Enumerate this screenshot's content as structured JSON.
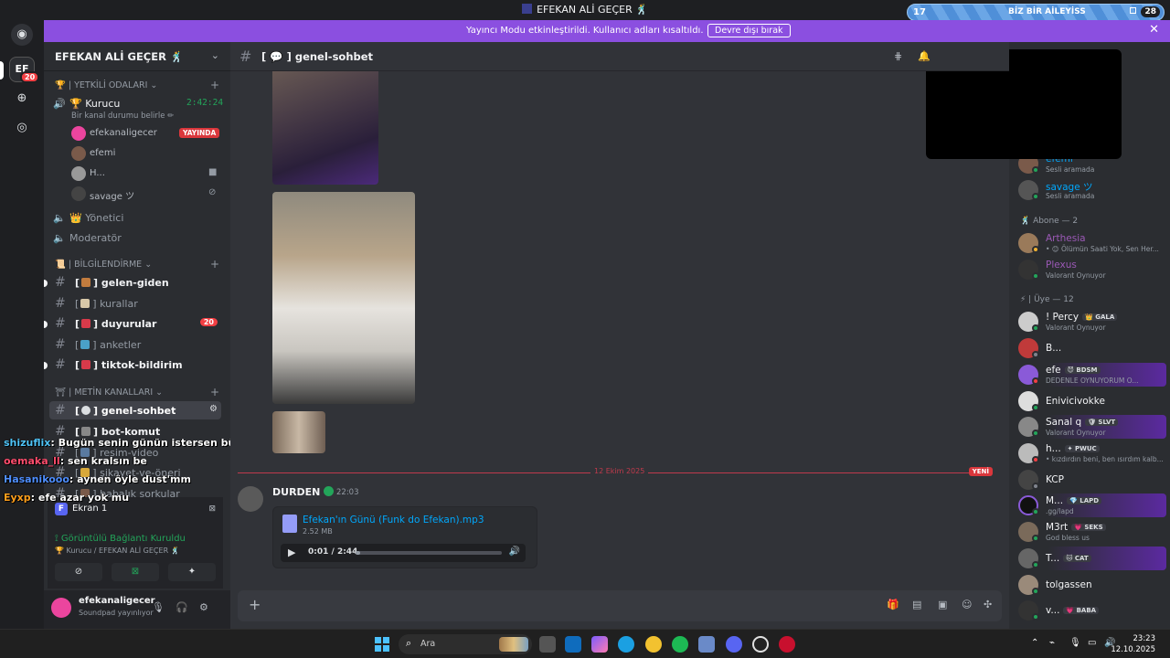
{
  "window": {
    "title": "EFEKAN ALİ GEÇER 🕺"
  },
  "mini_banner": {
    "left_num": "17",
    "text": "BİZ BİR AİLEYİSS",
    "right_num": "28"
  },
  "notice": {
    "message": "Yayıncı Modu etkinleştirildi. Kullanıcı adları kısaltıldı.",
    "button": "Devre dışı bırak"
  },
  "rail": {
    "server_badge": "20",
    "server_initials": "EF"
  },
  "server": {
    "name": "EFEKAN ALİ GEÇER 🕺"
  },
  "sidebar": {
    "cat_admin": "| YETKİLİ ODALARI ⌄",
    "voice_active": {
      "name": "🏆 Kurucu",
      "time": "2:42:24",
      "status": "Bir kanal durumu belirle ✏"
    },
    "voice_users": [
      {
        "name": "efekanaligecer",
        "live": "YAYINDA"
      },
      {
        "name": "efemi"
      },
      {
        "name": "H..."
      },
      {
        "name": "savage ツ"
      }
    ],
    "voice_others": [
      {
        "name": "👑 Yönetici"
      },
      {
        "name": "Moderatör"
      }
    ],
    "cat_info": "| BİLGİLENDİRME ⌄",
    "info_channels": [
      {
        "name": "gelen-giden"
      },
      {
        "name": "kurallar"
      },
      {
        "name": "duyurular",
        "count": "20"
      },
      {
        "name": "anketler"
      },
      {
        "name": "tiktok-bildirim"
      }
    ],
    "cat_text": "| METİN KANALLARI ⌄",
    "text_channels": [
      {
        "name": "genel-sohbet"
      },
      {
        "name": "bot-komut"
      },
      {
        "name": "resim-video"
      },
      {
        "name": "şikayet-ve-öneri"
      },
      {
        "name": "babalık sorkular"
      }
    ]
  },
  "overlay_chat": [
    {
      "user": "shizuflix",
      "text": ": Bugün senin günün istersen bütün molalar senin olsun",
      "color": "#4fc3f7"
    },
    {
      "user": "oemaka_ll",
      "text": ": sen kralsın be",
      "color": "#ff4d6d"
    },
    {
      "user": "Hasanikooo",
      "text": ": aynen öyle dust'mm",
      "color": "#4f8fff"
    },
    {
      "user": "Eyxp",
      "text": ": efe azar yok mu",
      "color": "#ff9f1c"
    }
  ],
  "voice_panel": {
    "screen": "Ekran 1",
    "connected": "Görüntülü Bağlantı Kuruldu",
    "location": "🏆 Kurucu / EFEKAN ALİ GEÇER 🕺"
  },
  "user": {
    "name": "efekanaligecer",
    "status": "Soundpad yayınlıyor"
  },
  "channel": {
    "name": "genel-sohbet"
  },
  "chat": {
    "date_divider": "12 Ekim 2025",
    "new_label": "YENİ",
    "message": {
      "author": "DURDEN",
      "time": "22:03"
    },
    "attachment": {
      "filename": "Efekan'ın Günü (Funk do Efekan).mp3",
      "size": "2.52 MB",
      "time": "0:01 / 2:44",
      "progress": 0.01
    }
  },
  "members": {
    "top": [
      {
        "name": "efemi",
        "activity": "Sesli aramada",
        "color": "#00a8fc"
      },
      {
        "name": "savage ツ",
        "activity": "Sesli aramada",
        "color": "#00a8fc"
      }
    ],
    "abone_header": "🕺 Abone — 2",
    "abone": [
      {
        "name": "Arthesia",
        "activity": "• 😊 Ölümün Saati Yok, Sen Her...",
        "color": "#9b59b6"
      },
      {
        "name": "Plexus",
        "activity": "Valorant Oynuyor",
        "color": "#9b59b6"
      }
    ],
    "uye_header": "⚡ | Üye — 12",
    "uye": [
      {
        "name": "! Percy",
        "tag": "👑 GALA",
        "activity": "Valorant Oynuyor"
      },
      {
        "name": "B..."
      },
      {
        "name": "efe",
        "tag": "😈 BDSM",
        "activity": "DEDENLE OYNUYORUM O..."
      },
      {
        "name": "Enivicivokke"
      },
      {
        "name": "Sanal q",
        "tag": "🛡 SLVT",
        "activity": "Valorant Oynuyor"
      },
      {
        "name": "h...",
        "tag": "✦ PWUC",
        "activity": "• kızdırdın beni, ben ısırdım kalb..."
      },
      {
        "name": "KCP"
      },
      {
        "name": "M...",
        "tag": "💎 LAPD",
        "activity": ".gg/lapd"
      },
      {
        "name": "M3rt",
        "tag": "💗 SEKS",
        "activity": "God bless us"
      },
      {
        "name": "T...",
        "tag": "🐱 CAT"
      },
      {
        "name": "tolgassen"
      },
      {
        "name": "v...",
        "tag": "💗 BABA"
      }
    ]
  },
  "taskbar": {
    "search": "Ara",
    "time": "23:23",
    "date": "12.10.2025"
  }
}
